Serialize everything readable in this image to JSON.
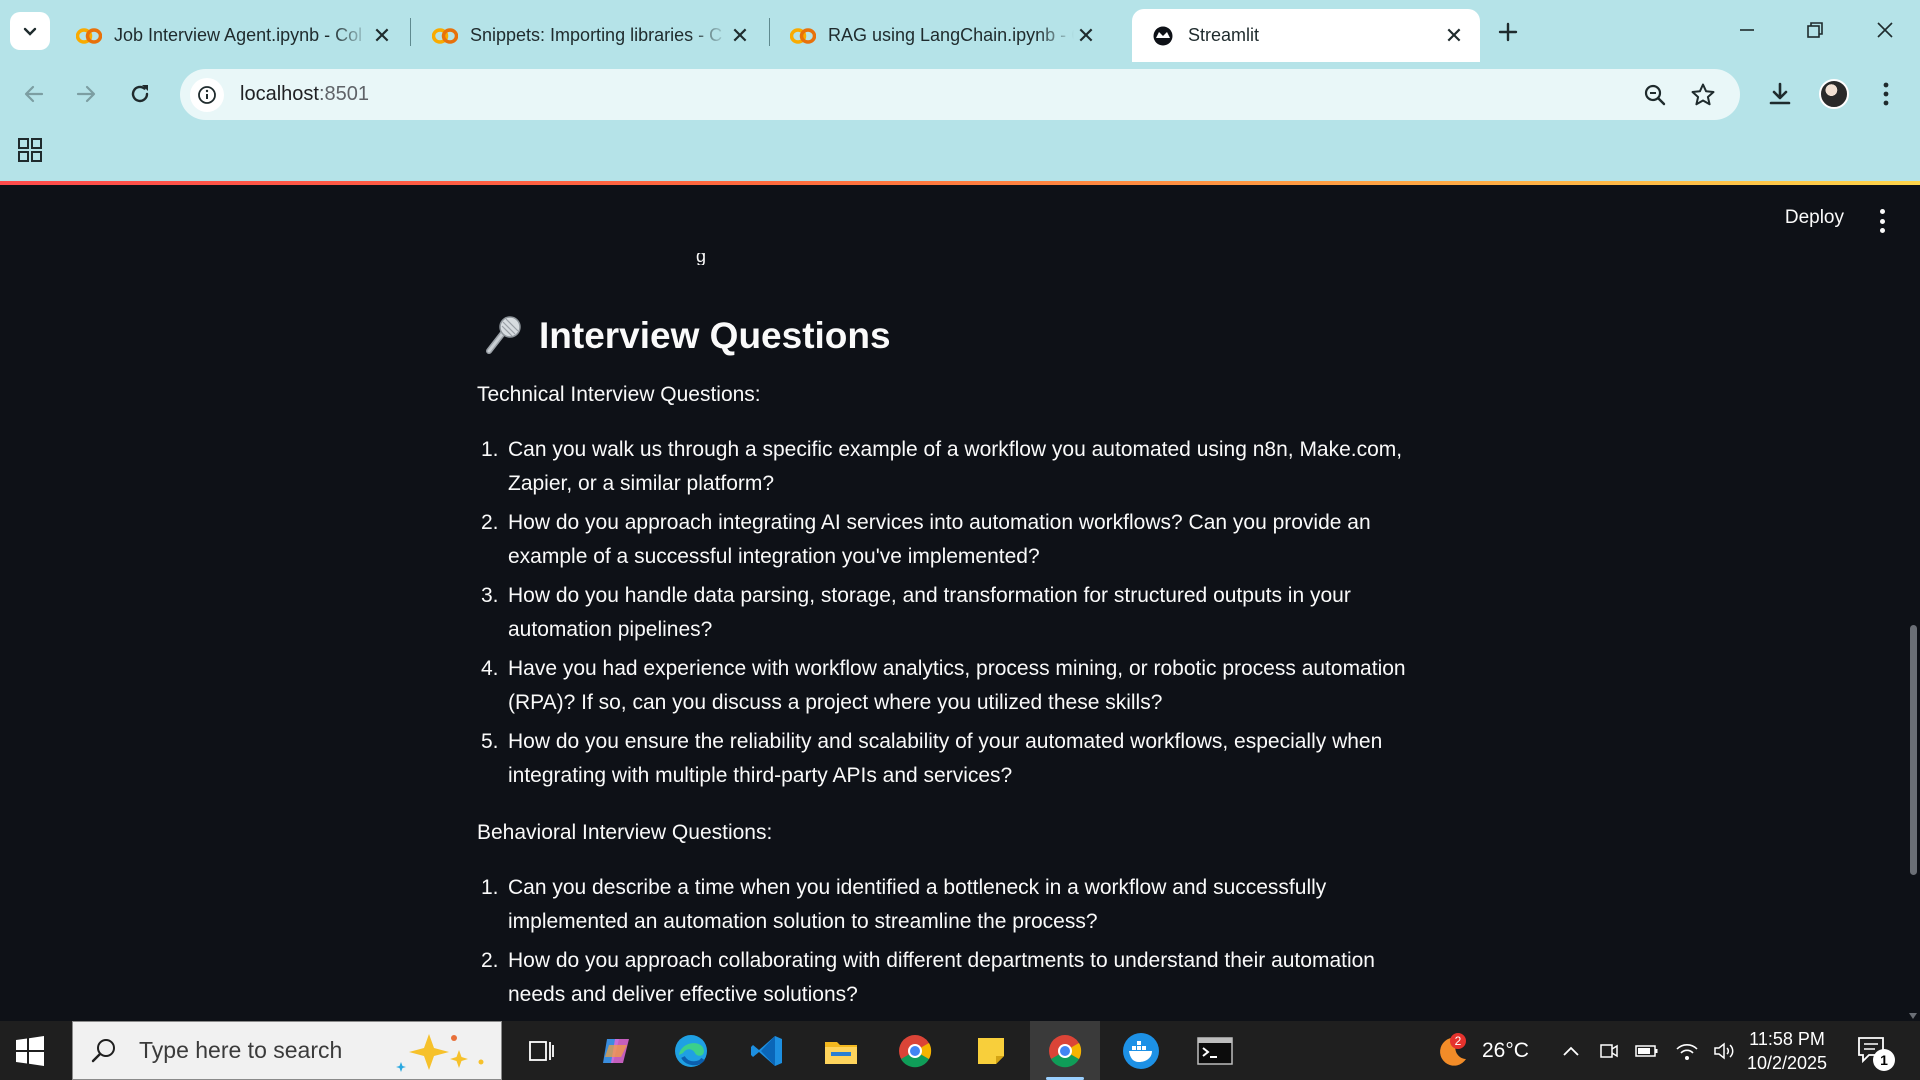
{
  "browser": {
    "tabs": [
      {
        "title": "Job Interview Agent.ipynb - Col",
        "icon": "colab-icon",
        "active": false
      },
      {
        "title": "Snippets: Importing libraries - C",
        "icon": "colab-icon",
        "active": false
      },
      {
        "title": "RAG using LangChain.ipynb - C",
        "icon": "colab-icon",
        "active": false
      },
      {
        "title": "Streamlit",
        "icon": "streamlit-icon",
        "active": true
      }
    ],
    "url_host": "localhost",
    "url_port": ":8501"
  },
  "app": {
    "deploy_label": "Deploy",
    "heading_icon": "microphone-icon",
    "heading": "Interview Questions",
    "technical_intro": "Technical Interview Questions:",
    "technical_questions": [
      {
        "num": "1.",
        "text": "Can you walk us through a specific example of a workflow you automated using n8n, Make.com, Zapier, or a similar platform?"
      },
      {
        "num": "2.",
        "text": "How do you approach integrating AI services into automation workflows? Can you provide an example of a successful integration you've implemented?"
      },
      {
        "num": "3.",
        "text": "How do you handle data parsing, storage, and transformation for structured outputs in your automation pipelines?"
      },
      {
        "num": "4.",
        "text": "Have you had experience with workflow analytics, process mining, or robotic process automation (RPA)? If so, can you discuss a project where you utilized these skills?"
      },
      {
        "num": "5.",
        "text": "How do you ensure the reliability and scalability of your automated workflows, especially when integrating with multiple third-party APIs and services?"
      }
    ],
    "behavioral_intro": "Behavioral Interview Questions:",
    "behavioral_questions": [
      {
        "num": "1.",
        "text": "Can you describe a time when you identified a bottleneck in a workflow and successfully implemented an automation solution to streamline the process?"
      },
      {
        "num": "2.",
        "text": "How do you approach collaborating with different departments to understand their automation needs and deliver effective solutions?"
      }
    ]
  },
  "taskbar": {
    "search_placeholder": "Type here to search",
    "weather_badge": "2",
    "temperature": "26°C",
    "time": "11:58 PM",
    "date": "10/2/2025",
    "notification_count": "1"
  },
  "colors": {
    "chrome_bg": "#b5e3e8",
    "app_bg": "#0e1117",
    "text": "#fafafa",
    "accent_red": "#ff4b4b"
  }
}
